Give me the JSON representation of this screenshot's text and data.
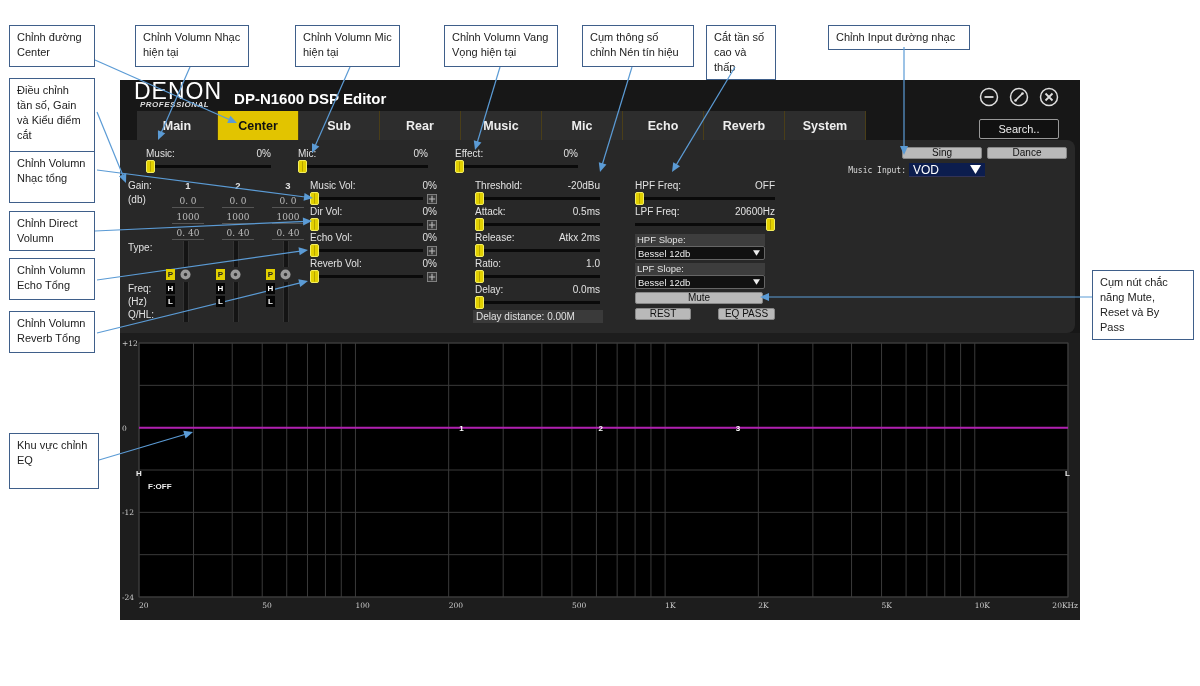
{
  "callouts": [
    {
      "text": "Chỉnh đường Center"
    },
    {
      "text": "Chỉnh Volumn Nhạc hiện tại"
    },
    {
      "text": "Chỉnh Volumn Mic hiện tại"
    },
    {
      "text": "Chỉnh Volumn Vang Vọng hiện tại"
    },
    {
      "text": "Cụm thông số chỉnh Nén tín hiệu"
    },
    {
      "text": "Cắt tần số cao và thấp"
    },
    {
      "text": "Chỉnh Input đường nhạc"
    },
    {
      "text": "Điều chỉnh tần số, Gain và Kiểu điểm cắt"
    },
    {
      "text": "Chỉnh Volumn Nhạc tổng"
    },
    {
      "text": "Chỉnh Direct Volumn"
    },
    {
      "text": "Chỉnh Volumn Echo Tổng"
    },
    {
      "text": "Cụm nút chắc năng Mute, Reset và By Pass"
    },
    {
      "text": "Chỉnh Volumn Reverb Tổng"
    },
    {
      "text": "Khu vực chỉnh EQ"
    }
  ],
  "app": {
    "logo": {
      "brand": "DENON",
      "tagline": "PROFESSIONAL"
    },
    "title": "DP-N1600 DSP Editor",
    "tabs": [
      {
        "label": "Main",
        "selected": false
      },
      {
        "label": "Center",
        "selected": true
      },
      {
        "label": "Sub",
        "selected": false
      },
      {
        "label": "Rear",
        "selected": false
      },
      {
        "label": "Music",
        "selected": false
      },
      {
        "label": "Mic",
        "selected": false
      },
      {
        "label": "Echo",
        "selected": false
      },
      {
        "label": "Reverb",
        "selected": false
      },
      {
        "label": "System",
        "selected": false
      }
    ],
    "search_button": "Search.."
  },
  "panel": {
    "music": {
      "label": "Music:",
      "reading": "0%",
      "level": 0
    },
    "mic": {
      "label": "Mic:",
      "reading": "0%",
      "level": 0
    },
    "effect": {
      "label": "Effect:",
      "reading": "0%",
      "level": 0
    },
    "gain_label": "Gain:",
    "db_label": "(db)",
    "type_label": "Type:",
    "freq_label": "Freq:",
    "hz_label": "(Hz)",
    "q_label": "Q/HL:",
    "bands": [
      {
        "number": "1",
        "gain": "0. 0",
        "frequency": "1000",
        "q": "0. 40",
        "filter_buttons": [
          {
            "label": "P",
            "selected": true
          },
          {
            "label": "H",
            "selected": false
          },
          {
            "label": "L",
            "selected": false
          }
        ]
      },
      {
        "number": "2",
        "gain": "0. 0",
        "frequency": "1000",
        "q": "0. 40",
        "filter_buttons": [
          {
            "label": "P",
            "selected": true
          },
          {
            "label": "H",
            "selected": false
          },
          {
            "label": "L",
            "selected": false
          }
        ]
      },
      {
        "number": "3",
        "gain": "0. 0",
        "frequency": "1000",
        "q": "0. 40",
        "filter_buttons": [
          {
            "label": "P",
            "selected": true
          },
          {
            "label": "H",
            "selected": false
          },
          {
            "label": "L",
            "selected": false
          }
        ]
      }
    ],
    "volumes": [
      {
        "label": "Music Vol:",
        "reading": "0%",
        "level": 0
      },
      {
        "label": "Dir Vol:",
        "reading": "0%",
        "level": 0
      },
      {
        "label": "Echo Vol:",
        "reading": "0%",
        "level": 0
      },
      {
        "label": "Reverb Vol:",
        "reading": "0%",
        "level": 0
      }
    ],
    "compressor": [
      {
        "label": "Threshold:",
        "reading": "-20dBu",
        "level": 0
      },
      {
        "label": "Attack:",
        "reading": "0.5ms",
        "level": 0
      },
      {
        "label": "Release:",
        "reading": "Atkx 2ms",
        "level": 0
      },
      {
        "label": "Ratio:",
        "reading": "1.0",
        "level": 0
      },
      {
        "label": "Delay:",
        "reading": "0.0ms",
        "level": 0
      }
    ],
    "delay_distance": "Delay distance: 0.00M",
    "filters": [
      {
        "label": "HPF Freq:",
        "reading": "OFF",
        "level": 0
      },
      {
        "label": "LPF Freq:",
        "reading": "20600Hz",
        "level": 1
      }
    ],
    "slopes": [
      {
        "label": "HPF Slope:",
        "value": "Bessel 12db"
      },
      {
        "label": "LPF Slope:",
        "value": "Bessel 12db"
      }
    ],
    "mute_button": "Mute",
    "reset_button": "REST",
    "eq_pass_button": "EQ PASS",
    "mode_buttons": [
      "Sing",
      "Dance"
    ],
    "music_input": {
      "label": "Music Input:",
      "value": "VOD"
    }
  },
  "eq": {
    "y_labels": [
      "+12",
      "0",
      "-12",
      "-24"
    ],
    "x_labels": [
      "20",
      "50",
      "100",
      "200",
      "500",
      "1K",
      "2K",
      "5K",
      "10K",
      "20KHz"
    ],
    "band_points": [
      "1",
      "2",
      "3"
    ],
    "low_marker": "H",
    "high_marker": "L",
    "filter_status": "F:OFF"
  }
}
